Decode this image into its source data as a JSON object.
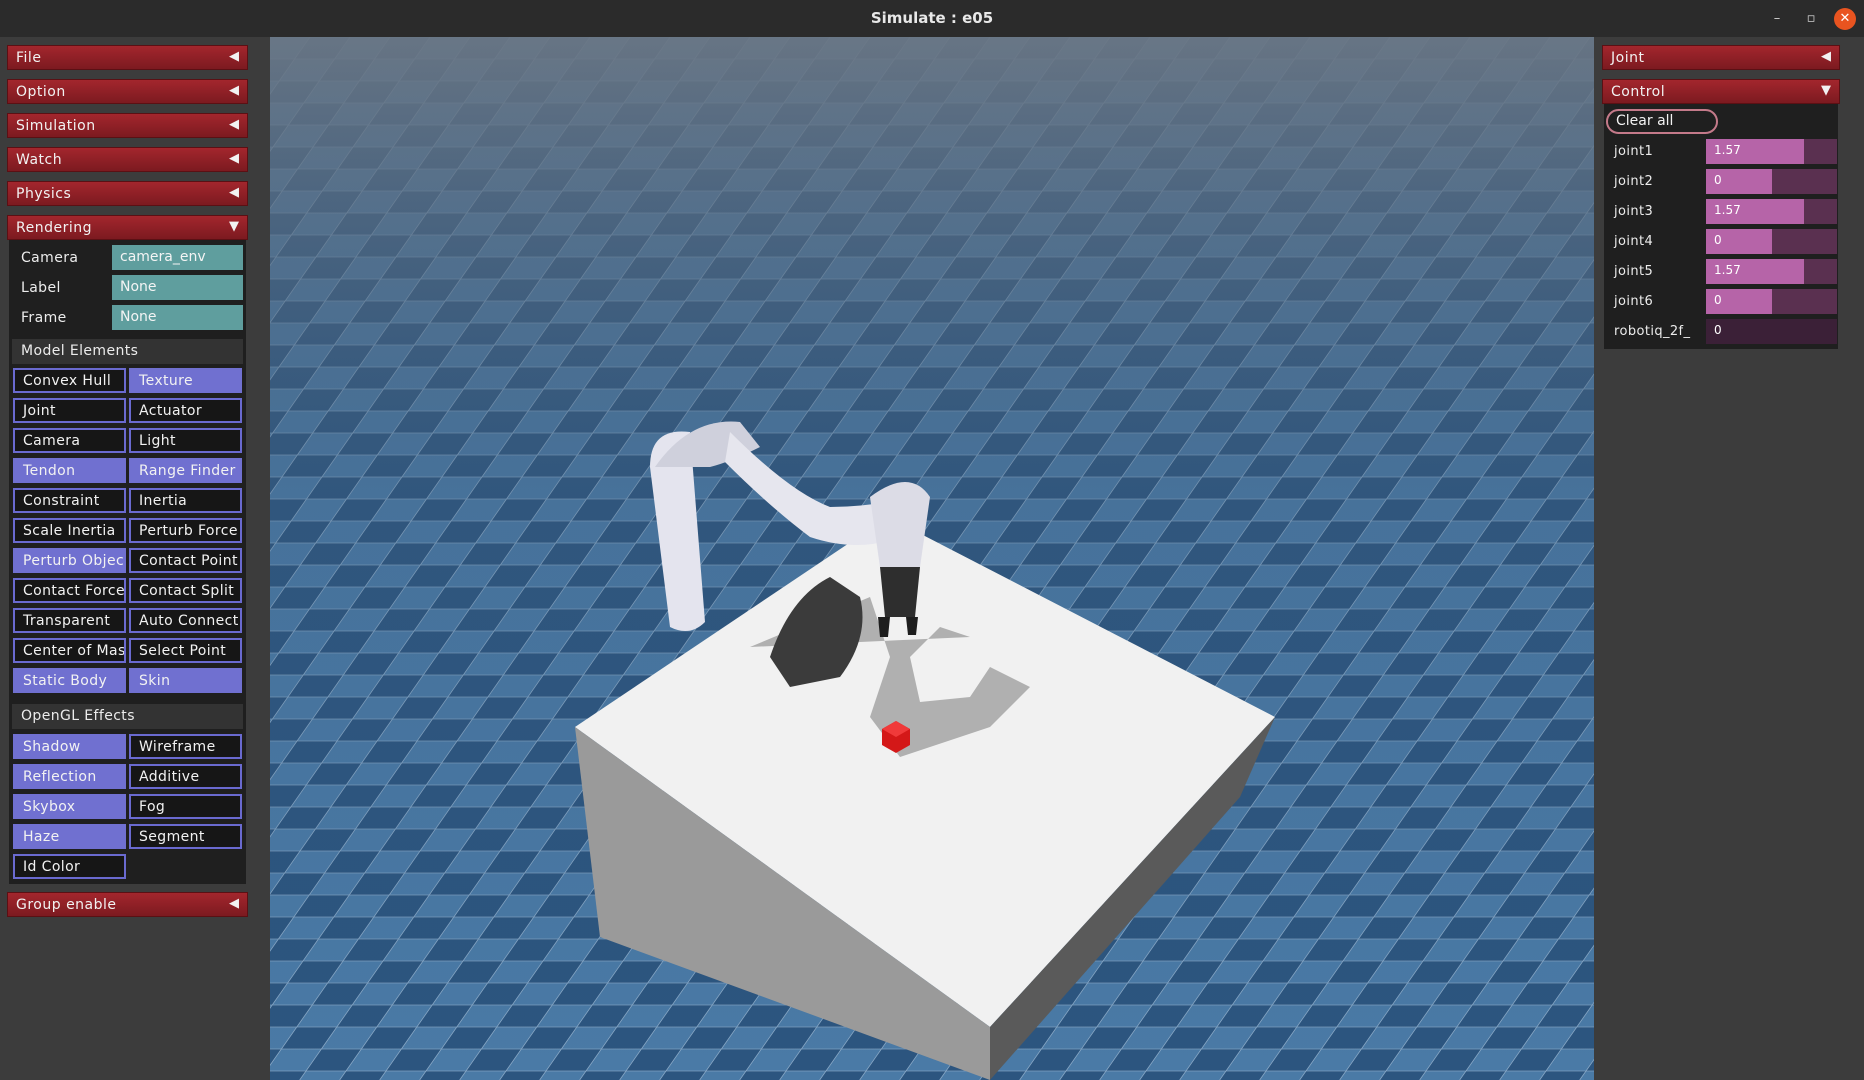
{
  "window": {
    "title": "Simulate : e05",
    "minimize": "–",
    "maximize": "▫",
    "close": "✕"
  },
  "left_panel": {
    "sections": [
      {
        "label": "File",
        "arrow": "◀"
      },
      {
        "label": "Option",
        "arrow": "◀"
      },
      {
        "label": "Simulation",
        "arrow": "◀"
      },
      {
        "label": "Watch",
        "arrow": "◀"
      },
      {
        "label": "Physics",
        "arrow": "◀"
      },
      {
        "label": "Rendering",
        "arrow": "▼"
      }
    ],
    "rendering": {
      "camera_label": "Camera",
      "camera_value": "camera_env",
      "label_label": "Label",
      "label_value": "None",
      "frame_label": "Frame",
      "frame_value": "None"
    },
    "model_elements": {
      "title": "Model Elements",
      "items": [
        {
          "label": "Convex Hull",
          "on": false
        },
        {
          "label": "Texture",
          "on": true
        },
        {
          "label": "Joint",
          "on": false
        },
        {
          "label": "Actuator",
          "on": false
        },
        {
          "label": "Camera",
          "on": false
        },
        {
          "label": "Light",
          "on": false
        },
        {
          "label": "Tendon",
          "on": true
        },
        {
          "label": "Range Finder",
          "on": true
        },
        {
          "label": "Constraint",
          "on": false
        },
        {
          "label": "Inertia",
          "on": false
        },
        {
          "label": "Scale Inertia",
          "on": false
        },
        {
          "label": "Perturb Force",
          "on": false
        },
        {
          "label": "Perturb Objec",
          "on": true
        },
        {
          "label": "Contact Point",
          "on": false
        },
        {
          "label": "Contact Force",
          "on": false
        },
        {
          "label": "Contact Split",
          "on": false
        },
        {
          "label": "Transparent",
          "on": false
        },
        {
          "label": "Auto Connect",
          "on": false
        },
        {
          "label": "Center of Mas",
          "on": false
        },
        {
          "label": "Select Point",
          "on": false
        },
        {
          "label": "Static Body",
          "on": true
        },
        {
          "label": "Skin",
          "on": true
        }
      ]
    },
    "opengl_effects": {
      "title": "OpenGL Effects",
      "items": [
        {
          "label": "Shadow",
          "on": true
        },
        {
          "label": "Wireframe",
          "on": false
        },
        {
          "label": "Reflection",
          "on": true
        },
        {
          "label": "Additive",
          "on": false
        },
        {
          "label": "Skybox",
          "on": true
        },
        {
          "label": "Fog",
          "on": false
        },
        {
          "label": "Haze",
          "on": true
        },
        {
          "label": "Segment",
          "on": false
        },
        {
          "label": "Id Color",
          "on": false
        }
      ]
    },
    "group_enable": {
      "label": "Group enable",
      "arrow": "◀"
    }
  },
  "right_panel": {
    "joint_section": {
      "label": "Joint",
      "arrow": "◀"
    },
    "control_section": {
      "label": "Control",
      "arrow": "▼"
    },
    "clear_all": "Clear all",
    "joints": [
      {
        "name": "joint1",
        "value": "1.57",
        "fraction": 0.75
      },
      {
        "name": "joint2",
        "value": "0",
        "fraction": 0.5
      },
      {
        "name": "joint3",
        "value": "1.57",
        "fraction": 0.75
      },
      {
        "name": "joint4",
        "value": "0",
        "fraction": 0.5
      },
      {
        "name": "joint5",
        "value": "1.57",
        "fraction": 0.75
      },
      {
        "name": "joint6",
        "value": "0",
        "fraction": 0.5
      },
      {
        "name": "robotiq_2f_",
        "value": "0",
        "fraction": 0.0
      }
    ]
  },
  "colors": {
    "section_red": "#8e2027",
    "toggle_on": "#7070d0",
    "select_teal": "#5f9e9e",
    "slider_fill": "#b664a8",
    "close_orange": "#e95420"
  }
}
